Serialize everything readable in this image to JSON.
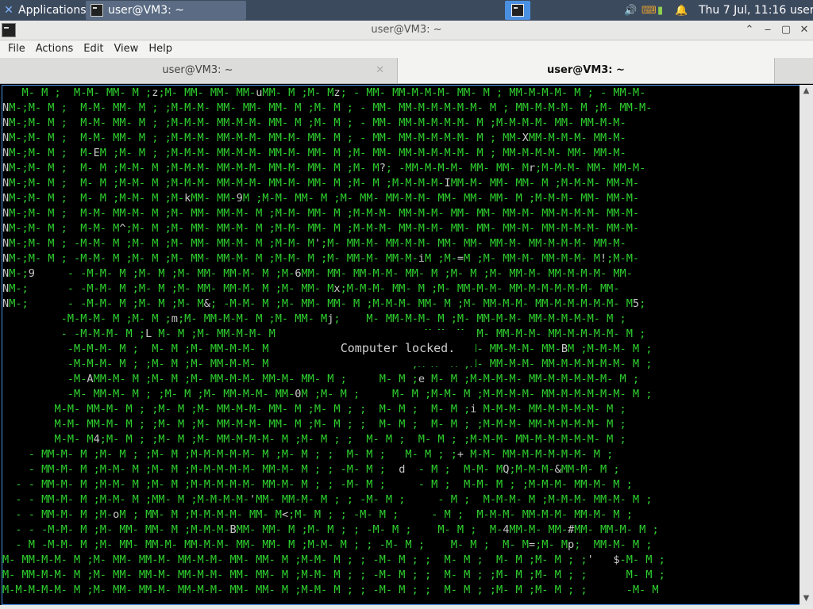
{
  "panel": {
    "applications_label": "Applications",
    "task_label": "user@VM3: ~",
    "clock": "Thu  7 Jul, 11:16",
    "user": "user"
  },
  "window": {
    "title": "user@VM3: ~",
    "buttons": {
      "minimize": "‒",
      "maximize": "▢",
      "close": "✕",
      "shade": "⌃"
    }
  },
  "menu": {
    "items": [
      "File",
      "Actions",
      "Edit",
      "View",
      "Help"
    ]
  },
  "tabs": [
    {
      "label": "user@VM3: ~",
      "active": false
    },
    {
      "label": "user@VM3: ~",
      "active": true
    }
  ],
  "terminal": {
    "lines": [
      "   M- M ;  M-M- MM- M ;z;M- MM- MM- MM-uMM- M ;M- Mz; - MM- MM-M-M-M- MM- M ; MM-M-M-M- M ; - MM-M-",
      "NM-;M- M ;  M-M- MM- M ; ;M-M-M- MM- MM- MM- M ;M- M ; - MM- MM-M-M-M-M-M- M ; MM-M-M-M- M ;M- MM-M-",
      "NM-;M- M ;  M-M- MM- M ; ;M-M-M- MM-M-M- MM- M ;M- M ; - MM- MM-M-M-M-M- M ;M-M-M-M- MM- MM-M-M-",
      "NM-;M- M ;  M-M- MM- M ; ;M-M-M- MM-M-M- MM-M- MM- M ; - MM- MM-M-M-M-M- M ; MM-XMM-M-M-M- MM-M-",
      "NM-;M- M ;  M-EM ;M- M ; ;M-M-M- MM-M-M- MM-M- MM- M ;M- MM- MM-M-M-M-M- M ; MM-M-M-M- MM- MM-M-",
      "NM-;M- M ;  M- M ;M-M- M ;M-M-M- MM-M-M- MM-M- MM- M ;M- M?; -MM-M-M-M- MM- MM- Mr;M-M-M- MM- MM-M-",
      "NM-;M- M ;  M- M ;M-M- M ;M-M-M- MM-M-M- MM-M- MM- M ;M- M ;M-M-M-M-IMM-M- MM- MM- M ;M-M-M- MM-M-",
      "NM-;M- M ;  M- M ;M-M- M ;M-kMM- MM-9M ;M-M- MM- M ;M- MM- MM-M-M- MM- MM- MM- M ;M-M-M- MM- MM-M-",
      "NM-;M- M ;  M-M- MM-M- M ;M- MM- MM-M- M ;M-M- MM- M ;M-M-M- MM-M-M- MM- MM- MM-M- MM-M-M-M- MM-M-",
      "NM-;M- M ;  M-M- M^;M- M ;M- MM- MM-M- M ;M-M- MM- M ;M-M-M- MM-M-M- MM- MM- MM-M- MM-M-M-M- MM-M-",
      "NM-;M- M ; -M-M- M ;M- M ;M- MM- MM-M- M ;M-M- M';M- MM-M- MM-M-M- MM- MM- MM-M- MM-M-M-M- MM-M-",
      "NM-;M- M ; -M-M- M ;M- M ;M- MM- MM-M- M ;M-M- M ;M- MM-M- MM-M-iM ;M-=M ;M- MM-M- MM-M-M- M!;M-M-",
      "NM-;9     - -M-M- M ;M- M ;M- MM- MM-M- M ;M-6MM- MM- MM-M-M- MM- M ;M- M ;M- MM-M- MM-M-M-M- MM-",
      "NM-;      - -M-M- M ;M- M ;M- MM- MM-M- M ;M- MM- Mx;M-M-M- MM- M ;M- MM-M-M- MM-M-M-M-M-M- MM-",
      "NM-;      - -M-M- M ;M- M ;M- M&; -M-M- M ;M- MM- MM- M ;M-M-M- MM- M ;M- MM-M-M- MM-M-M-M-M-M- M5;",
      "         -M-M-M- M ;M- M ;m;M- MM-M-M- M ;M- MM- Mj;    M- MM-M-M- M ;M- MM-M-M- MM-M-M-M-M- M ;",
      "         - -M-M-M- M ;L M- M ;M- MM-M-M- M                     @;M-M- M ;M- MM-M-M- MM-M-M-M-M- M ;",
      "          -M-M-M- M ;  M- M ;M- MM-M-M- M                      ;M-M- M ;M- MM-M-M- MM-BM ;M-M-M- M ;",
      "          -M-M-M- M ; ;M- M ;M- MM-M-M- M                      ;M-M- M ;M- MM-M-M- MM-M-M-M-M-M- M ;",
      "          -M-AMM-M- M ;M- M ;M- MM-M-M- MM-M- MM- M ;     M- M ;e M- M ;M-M-M-M- MM-M-M-M-M-M- M ;",
      "          -M- MM-M- M ; ;M- M ;M- MM-M-M- MM-0M ;M- M ;     M- M ;M-M- M ;M-M-M-M- MM-M-M-M-M-M- M ;",
      "        M-M- MM-M- M ; ;M- M ;M- MM-M-M- MM- M ;M- M ; ;  M- M ;  M- M ;i M-M-M- MM-M-M-M-M- M ;",
      "        M-M- MM-M- M ; ;M- M ;M- MM-M-M- MM- M ;M- M ; ;  M- M ;  M- M ; ;M-M-M- MM-M-M-M-M- M ;",
      "        M-M- M4;M- M ; ;M- M ;M- MM-M-M-M- M ;M- M ; ;  M- M ;  M- M ; ;M-M-M- MM-M-M-M-M-M- M ;",
      "    - MM-M- M ;M- M ; ;M- M ;M-M-M-M-M- M ;M- M ; ;  M- M ;   M- M ; ;+ M-M- MM-M-M-M-M-M- M ;",
      "    - MM-M- M ;M-M- M ;M- M ;M-M-M-M-M- MM-M- M ; ; -M- M ;  d  - M ;  M-M- MQ;M-M-M-&MM-M- M ;",
      "  - - MM-M- M ;M-M- M ;M- M ;M-M-M-M-M- MM-M- M ; ; -M- M ;     - M ;  M-M- M ; ;M-M-M- MM-M- M ;",
      "  - - MM-M- M ;M-M- M ;MM- M ;M-M-M-M-'MM- MM-M- M ; ; -M- M ;     - M ;  M-M-M- M ;M-M-M- MM-M- M ;",
      "  - - MM-M- M ;M-oM ; MM- M ;M-M-M-M- MM- M<;M- M ; ; -M- M ;     - M ;  M-M-M- MM-M-M- MM-M- M ;",
      "  - - -M-M- M ;M- MM- MM- M ;M-M-M-BMM- MM- M ;M- M ; ; -M- M ;    M- M ;  M-4MM-M- MM-#MM- MM-M- M ;",
      "  - M -M-M- M ;M- MM- MM-M- MM-M-M- MM- MM- M ;M-M- M ; ; -M- M ;    M- M ;  M- M=;M- Mp;  MM-M- M ;",
      "M- MM-M-M- M ;M- MM- MM-M- MM-M-M- MM- MM- M ;M-M- M ; ; -M- M ; ;  M- M ;  M- M ;M- M ; ;'   $-M- M ;",
      "M- MM-M-M- M ;M- MM- MM-M- MM-M-M- MM- MM- M ;M-M- M ; ; -M- M ; ;  M- M ; ;M- M ;M- M ; ;      M- M ;",
      "M-M-M-M-M- M ;M- MM- MM-M- MM-M-M- MM- MM- M ;M-M- M ; ; -M- M ; ;  M- M ; ;M- M ;M- M ; ;      -M- M"
    ]
  },
  "lock_message": "Computer locked.",
  "colors": {
    "panel_bg": "#3c4a5e",
    "terminal_fg": "#2fd12f",
    "terminal_bg": "#000000",
    "accent": "#4a90e2"
  },
  "icons": {
    "applications": "xfce-mouse-icon",
    "terminal": "terminal-icon",
    "volume": "volume-icon",
    "network": "network-icon",
    "battery": "battery-icon",
    "notifications": "bell-icon"
  }
}
